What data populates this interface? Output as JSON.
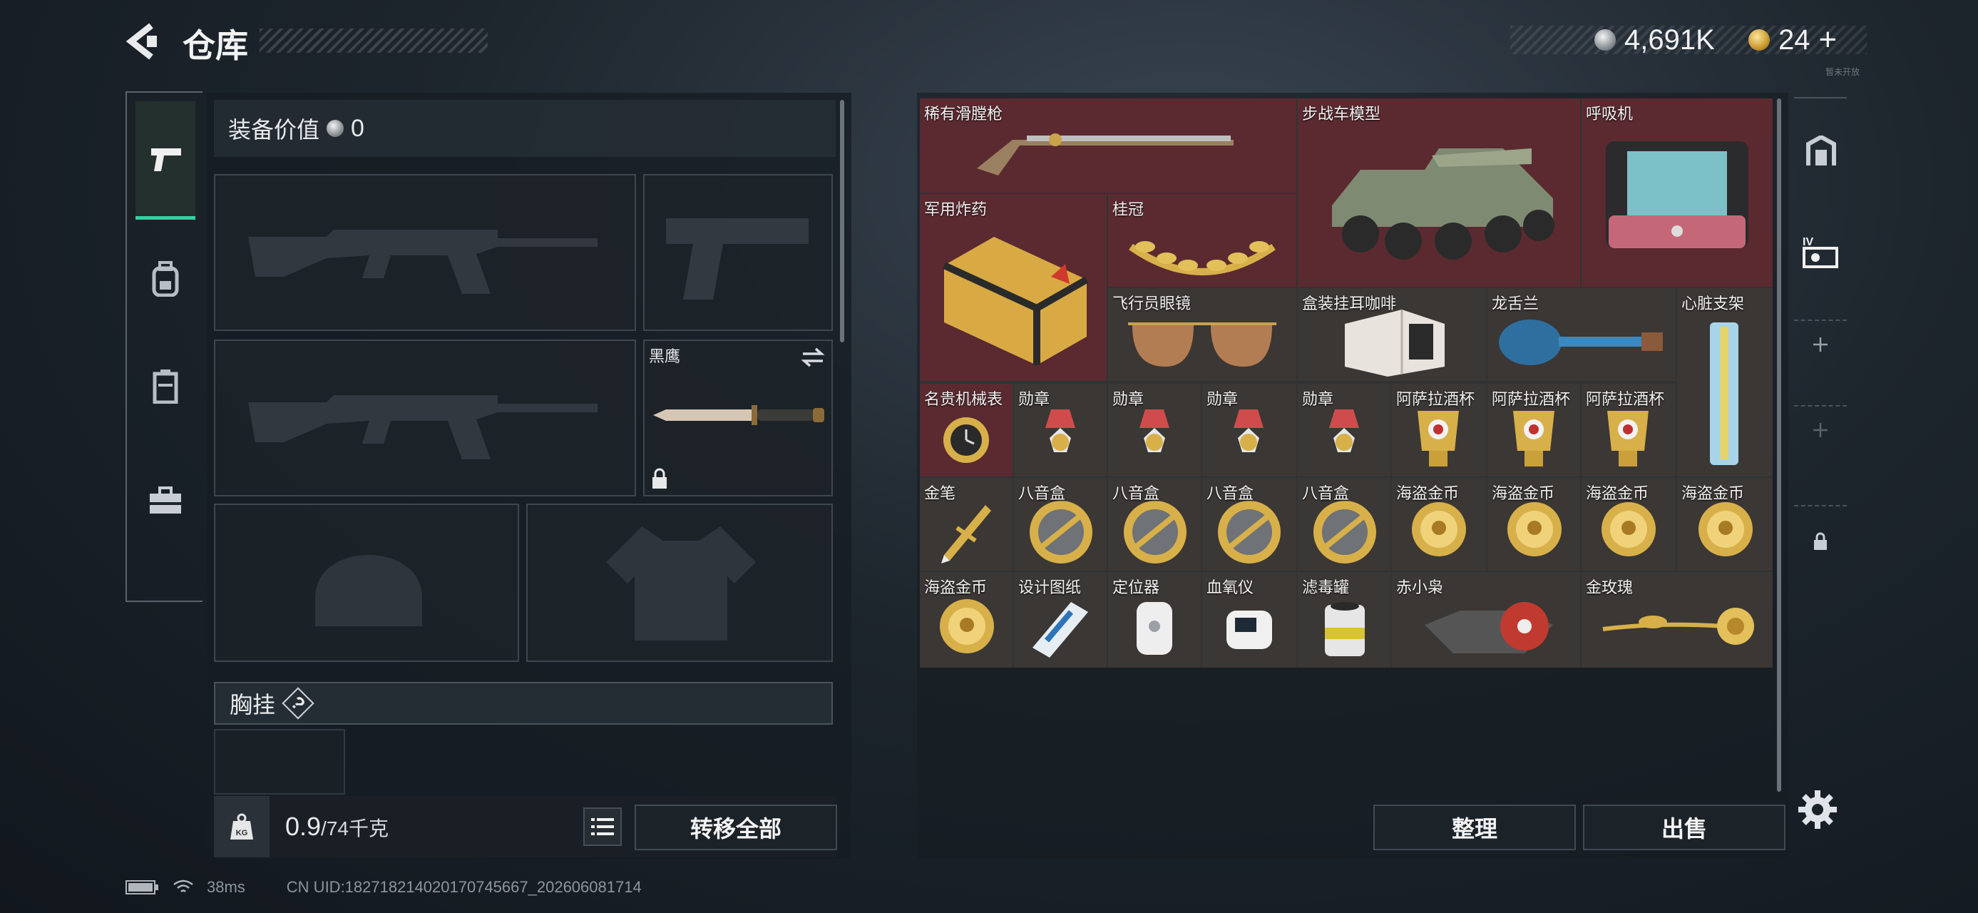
{
  "header": {
    "title": "仓库",
    "currency_amount": "4,691K",
    "tickets": "24",
    "tickets_add": "+",
    "version": "暂未开放"
  },
  "loadout": {
    "value_label": "装备价值",
    "value": "0",
    "melee_name": "黑鹰",
    "chest_rig_label": "胸挂",
    "chest_help": "?",
    "weight_icon_text": "KG",
    "weight_current": "0.9",
    "weight_max": "/74千克",
    "transfer_all": "转移全部"
  },
  "left_tabs": [
    "weapon-tab",
    "backpack-tab",
    "bag-tab",
    "toolbox-tab"
  ],
  "stash_items": [
    {
      "id": "flintlock",
      "name": "稀有滑膛枪",
      "icon": "flintlock-rifle-icon"
    },
    {
      "id": "ifv",
      "name": "步战车模型",
      "icon": "ifv-model-icon"
    },
    {
      "id": "ventilator",
      "name": "呼吸机",
      "icon": "ventilator-icon"
    },
    {
      "id": "explosives",
      "name": "军用炸药",
      "icon": "explosive-crate-icon"
    },
    {
      "id": "laurel",
      "name": "桂冠",
      "icon": "laurel-crown-icon"
    },
    {
      "id": "aviators",
      "name": "飞行员眼镜",
      "icon": "aviator-glasses-icon"
    },
    {
      "id": "coffee",
      "name": "盒装挂耳咖啡",
      "icon": "coffee-box-icon"
    },
    {
      "id": "dragon",
      "name": "龙舌兰",
      "icon": "tequila-bottle-icon"
    },
    {
      "id": "stent",
      "name": "心脏支架",
      "icon": "heart-stent-icon"
    },
    {
      "id": "watch",
      "name": "名贵机械表",
      "icon": "luxury-watch-icon"
    },
    {
      "id": "medal1",
      "name": "勋章",
      "icon": "medal-icon"
    },
    {
      "id": "medal2",
      "name": "勋章",
      "icon": "medal-icon"
    },
    {
      "id": "medal3",
      "name": "勋章",
      "icon": "medal-icon"
    },
    {
      "id": "medal4",
      "name": "勋章",
      "icon": "medal-icon"
    },
    {
      "id": "cup1",
      "name": "阿萨拉酒杯",
      "icon": "wine-cup-icon"
    },
    {
      "id": "cup2",
      "name": "阿萨拉酒杯",
      "icon": "wine-cup-icon"
    },
    {
      "id": "cup3",
      "name": "阿萨拉酒杯",
      "icon": "wine-cup-icon"
    },
    {
      "id": "pen",
      "name": "金笔",
      "icon": "gold-pen-icon"
    },
    {
      "id": "mb1",
      "name": "八音盒",
      "icon": "music-box-icon"
    },
    {
      "id": "mb2",
      "name": "八音盒",
      "icon": "music-box-icon"
    },
    {
      "id": "mb3",
      "name": "八音盒",
      "icon": "music-box-icon"
    },
    {
      "id": "mb4",
      "name": "八音盒",
      "icon": "music-box-icon"
    },
    {
      "id": "pc1",
      "name": "海盗金币",
      "icon": "pirate-coin-icon"
    },
    {
      "id": "pc2",
      "name": "海盗金币",
      "icon": "pirate-coin-icon"
    },
    {
      "id": "pc3",
      "name": "海盗金币",
      "icon": "pirate-coin-icon"
    },
    {
      "id": "pc4",
      "name": "海盗金币",
      "icon": "pirate-coin-icon"
    },
    {
      "id": "pc5",
      "name": "海盗金币",
      "icon": "pirate-coin-icon"
    },
    {
      "id": "blueprint",
      "name": "设计图纸",
      "icon": "blueprint-icon"
    },
    {
      "id": "locator",
      "name": "定位器",
      "icon": "locator-icon"
    },
    {
      "id": "oximeter",
      "name": "血氧仪",
      "icon": "oximeter-icon"
    },
    {
      "id": "canister",
      "name": "滤毒罐",
      "icon": "filter-canister-icon"
    },
    {
      "id": "owl",
      "name": "赤小枭",
      "icon": "red-owl-drone-icon"
    },
    {
      "id": "rose",
      "name": "金玫瑰",
      "icon": "golden-rose-icon"
    }
  ],
  "right_actions": {
    "sort": "整理",
    "sell": "出售"
  },
  "right_tabs": [
    "safe-box-tab",
    "container-tab",
    "add-slot-1",
    "add-slot-2",
    "locked-slot"
  ],
  "status_bar": {
    "ping": "38ms",
    "uid": "CN UID:18271821402017074566​7_202606081714"
  },
  "colors": {
    "accent": "#2fd3a0",
    "valuable": "#5b2a30",
    "common": "#3b3734",
    "gold": "#d8b04a"
  }
}
